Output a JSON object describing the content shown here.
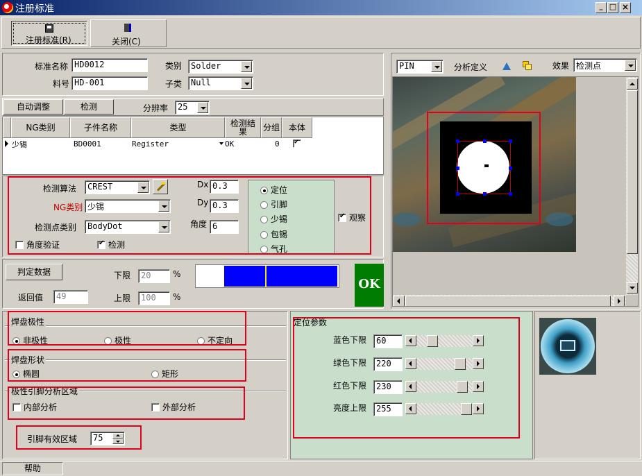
{
  "window": {
    "title": "注册标准",
    "min": "_",
    "max": "□",
    "close": "×"
  },
  "toolbar": {
    "register_label": "注册标准(R)",
    "close_label": "关闭(C)"
  },
  "std": {
    "name_label": "标准名称",
    "name_value": "HD0012",
    "part_label": "料号",
    "part_value": "HD-001",
    "category_label": "类别",
    "category_value": "Solder",
    "subcat_label": "子类",
    "subcat_value": "Null"
  },
  "actions": {
    "auto_adjust": "自动调整",
    "detect": "检测",
    "res_label": "分辨率",
    "res_value": "25"
  },
  "grid": {
    "headers": [
      "NG类别",
      "子件名称",
      "类型",
      "检测结果",
      "分组",
      "本体"
    ],
    "row": {
      "ng": "少锡",
      "child": "BD0001",
      "type": "Register",
      "result": "OK",
      "group": "0",
      "body_checked": true
    }
  },
  "algo": {
    "method_label": "检测算法",
    "method_value": "CREST",
    "ng_label": "NG类别",
    "ng_value": "少锡",
    "pointtype_label": "检测点类别",
    "pointtype_value": "BodyDot",
    "dx_label": "Dx",
    "dx_value": "0.3",
    "dy_label": "Dy",
    "dy_value": "0.3",
    "angle_label": "角度",
    "angle_value": "6",
    "angle_verify": "角度验证",
    "detect_check": "检测",
    "modes": [
      "定位",
      "引脚",
      "少锡",
      "包锡",
      "气孔"
    ],
    "observe": "观察"
  },
  "judge": {
    "btn": "判定数据",
    "return_label": "返回值",
    "return_value": "49",
    "lower_label": "下限",
    "lower_value": "20",
    "upper_label": "上限",
    "upper_value": "100",
    "pct": "%",
    "result": "OK",
    "bar_fill": 0.49,
    "colors": {
      "bar": "#0000ff",
      "marker": "#f4e400",
      "ok_bg": "#007c00"
    }
  },
  "view": {
    "pin_value": "PIN",
    "analysis_label": "分析定义",
    "effect_label": "效果",
    "effect_value": "检测点"
  },
  "pad": {
    "polarity_title": "焊盘极性",
    "polarity_opts": [
      "非极性",
      "极性",
      "不定向"
    ],
    "shape_title": "焊盘形状",
    "shape_opts": [
      "椭圆",
      "矩形"
    ],
    "pin_area_title": "极性引脚分析区域",
    "inner": "内部分析",
    "outer": "外部分析",
    "eff_label": "引脚有效区域",
    "eff_value": "75"
  },
  "locate": {
    "title": "定位参数",
    "params": [
      {
        "label": "蓝色下限",
        "value": "60",
        "pos": 0.24
      },
      {
        "label": "绿色下限",
        "value": "220",
        "pos": 0.86
      },
      {
        "label": "红色下限",
        "value": "230",
        "pos": 0.9
      },
      {
        "label": "亮度上限",
        "value": "255",
        "pos": 1.0
      }
    ]
  },
  "status": {
    "help": "帮助"
  },
  "icons": [
    "app-icon",
    "save-icon",
    "exit-icon",
    "wand-icon",
    "triangle-tool-icon",
    "copy-icon"
  ]
}
